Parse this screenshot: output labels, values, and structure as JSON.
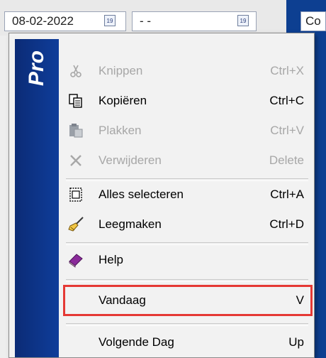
{
  "toolbar": {
    "date_from": "08-02-2022",
    "date_to": "- -",
    "calendar_icon": "calendar-icon",
    "right_button": "Co"
  },
  "menu": {
    "brand": "Pro",
    "items": [
      {
        "label": "Knippen",
        "shortcut": "Ctrl+X",
        "enabled": false,
        "icon": "scissors-icon"
      },
      {
        "label": "Kopiëren",
        "shortcut": "Ctrl+C",
        "enabled": true,
        "icon": "copy-icon"
      },
      {
        "label": "Plakken",
        "shortcut": "Ctrl+V",
        "enabled": false,
        "icon": "paste-icon"
      },
      {
        "label": "Verwijderen",
        "shortcut": "Delete",
        "enabled": false,
        "icon": "delete-icon"
      },
      {
        "label": "Alles selecteren",
        "shortcut": "Ctrl+A",
        "enabled": true,
        "icon": "select-all-icon"
      },
      {
        "label": "Leegmaken",
        "shortcut": "Ctrl+D",
        "enabled": true,
        "icon": "broom-icon"
      },
      {
        "label": "Help",
        "shortcut": "",
        "enabled": true,
        "icon": "help-book-icon"
      },
      {
        "label": "Vandaag",
        "shortcut": "V",
        "enabled": true,
        "highlighted": true
      },
      {
        "label": "Volgende Dag",
        "shortcut": "Up",
        "enabled": true
      }
    ]
  },
  "colors": {
    "menu_side": "#0f3d9a",
    "highlight_border": "#e53935",
    "disabled_text": "#a7a7a7"
  }
}
